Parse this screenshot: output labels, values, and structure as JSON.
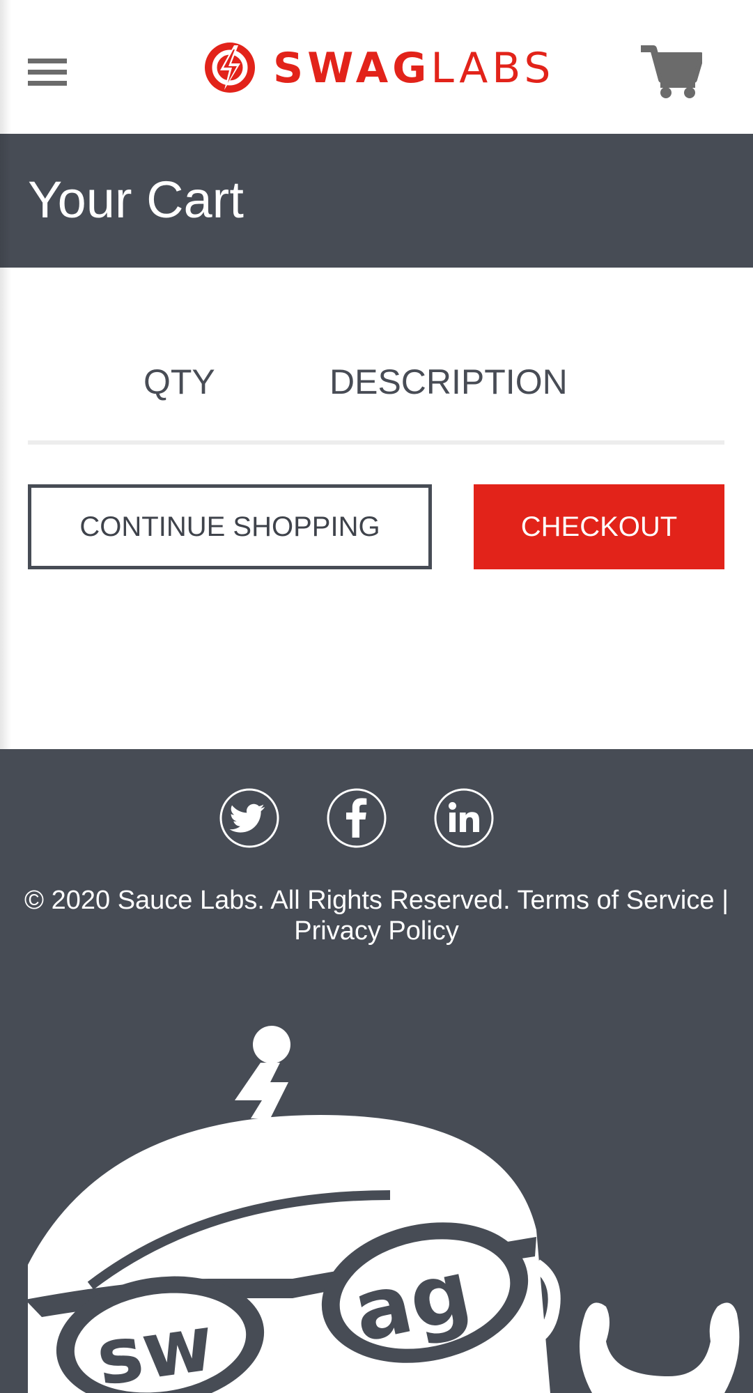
{
  "header": {
    "brand_bold": "SWAG",
    "brand_light": "LABS",
    "menu_icon": "hamburger-menu-icon",
    "cart_icon": "shopping-cart-icon"
  },
  "page": {
    "title": "Your Cart"
  },
  "cart": {
    "columns": [
      "QTY",
      "DESCRIPTION"
    ],
    "items": []
  },
  "actions": {
    "continue_label": "CONTINUE SHOPPING",
    "checkout_label": "CHECKOUT"
  },
  "footer": {
    "social": [
      "twitter-icon",
      "facebook-icon",
      "linkedin-icon"
    ],
    "copyright": "© 2020 Sauce Labs. All Rights Reserved.",
    "terms": "Terms of Service",
    "separator": "|",
    "privacy": "Privacy Policy",
    "mascot_text_1": "sw",
    "mascot_text_2": "ag"
  },
  "colors": {
    "brand_red": "#e2231a",
    "dark_slate": "#474c55",
    "icon_gray": "#6b6b6b"
  }
}
